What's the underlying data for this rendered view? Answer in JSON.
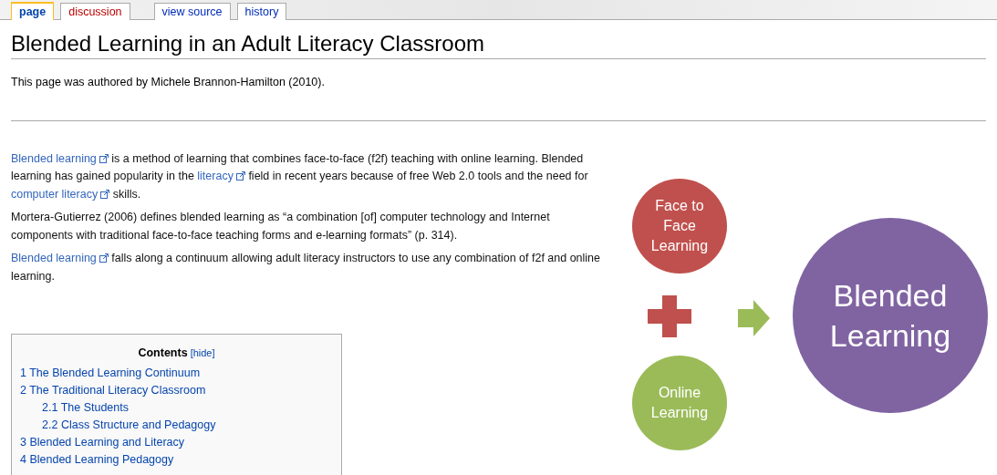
{
  "tab_groups": [
    [
      {
        "label": "page",
        "selected": true,
        "exists": true
      },
      {
        "label": "discussion",
        "selected": false,
        "exists": false
      }
    ],
    [
      {
        "label": "view source",
        "selected": false,
        "exists": true
      },
      {
        "label": "history",
        "selected": false,
        "exists": true
      }
    ]
  ],
  "title": "Blended Learning in an Adult Literacy Classroom",
  "author_line": "This page was authored by Michele Brannon-Hamilton (2010).",
  "paragraphs": [
    [
      {
        "kind": "link",
        "text": "Blended learning"
      },
      {
        "kind": "text",
        "text": " is a method of learning that combines face-to-face (f2f) teaching with online learning. Blended learning has gained popularity in the "
      },
      {
        "kind": "link",
        "text": "literacy"
      },
      {
        "kind": "text",
        "text": " field in recent years because of free Web 2.0 tools and the need for "
      },
      {
        "kind": "link",
        "text": "computer literacy"
      },
      {
        "kind": "text",
        "text": " skills."
      }
    ],
    [
      {
        "kind": "text",
        "text": "Mortera-Gutierrez (2006) defines blended learning as “a combination [of] computer technology and Internet components with traditional face-to-face teaching forms and e-learning formats” (p. 314)."
      }
    ],
    [
      {
        "kind": "link",
        "text": "Blended learning"
      },
      {
        "kind": "text",
        "text": " falls along a continuum allowing adult literacy instructors to use any combination of f2f and online learning."
      }
    ]
  ],
  "toc": {
    "title": "Contents",
    "toggle": "[hide]",
    "items": [
      {
        "number": "1",
        "label": "The Blended Learning Continuum"
      },
      {
        "number": "2",
        "label": "The Traditional Literacy Classroom",
        "children": [
          {
            "number": "2.1",
            "label": "The Students"
          },
          {
            "number": "2.2",
            "label": "Class Structure and Pedagogy"
          }
        ]
      },
      {
        "number": "3",
        "label": "Blended Learning and Literacy"
      },
      {
        "number": "4",
        "label": "Blended Learning Pedagogy"
      }
    ]
  },
  "diagram": {
    "face_to_face": "Face to Face Learning",
    "online": "Online Learning",
    "result": "Blended Learning"
  }
}
